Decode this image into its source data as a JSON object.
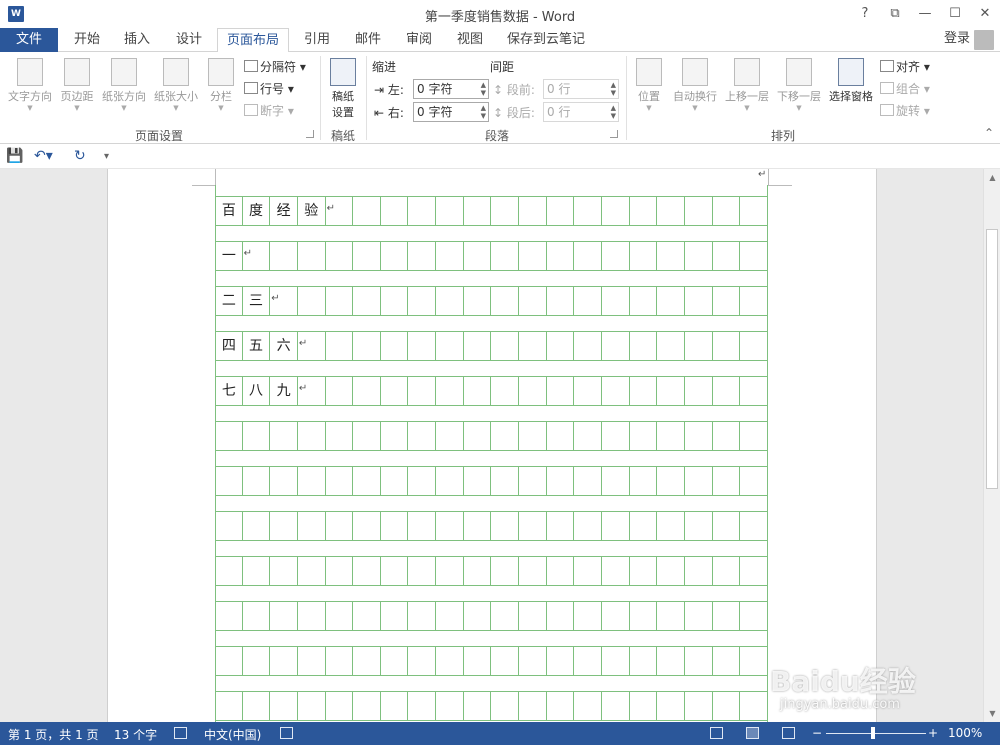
{
  "window": {
    "title": "第一季度销售数据 - Word",
    "help": "?",
    "restore_ribbon": "⧉",
    "minimize": "—",
    "maximize": "☐",
    "close": "✕"
  },
  "tabs": {
    "file": "文件",
    "items": [
      "开始",
      "插入",
      "设计",
      "页面布局",
      "引用",
      "邮件",
      "审阅",
      "视图",
      "保存到云笔记"
    ],
    "active": "页面布局",
    "login": "登录"
  },
  "ribbon": {
    "page_setup": {
      "label": "页面设置",
      "text_direction": "文字方向",
      "margins": "页边距",
      "orientation": "纸张方向",
      "size": "纸张大小",
      "columns": "分栏",
      "breaks": "分隔符",
      "line_numbers": "行号",
      "hyphenation": "断字"
    },
    "manuscript": {
      "label": "稿纸",
      "settings_line1": "稿纸",
      "settings_line2": "设置"
    },
    "paragraph": {
      "label": "段落",
      "indent_title": "缩进",
      "spacing_title": "间距",
      "left_label": "左:",
      "right_label": "右:",
      "left_value": "0 字符",
      "right_value": "0 字符",
      "before_label": "段前:",
      "after_label": "段后:",
      "before_value": "0 行",
      "after_value": "0 行"
    },
    "arrange": {
      "label": "排列",
      "position": "位置",
      "wrap_text": "自动换行",
      "bring_forward": "上移一层",
      "send_backward": "下移一层",
      "selection_pane": "选择窗格",
      "align": "对齐",
      "group": "组合",
      "rotate": "旋转"
    }
  },
  "document": {
    "rows": [
      [
        "百",
        "度",
        "经",
        "验"
      ],
      [
        "一"
      ],
      [
        "二",
        "三"
      ],
      [
        "四",
        "五",
        "六"
      ],
      [
        "七",
        "八",
        "九"
      ],
      [],
      [],
      [],
      [],
      [],
      [],
      []
    ],
    "paragraph_mark": "↵",
    "grid_color": "#7ec07e"
  },
  "statusbar": {
    "page": "第 1 页，共 1 页",
    "words": "13 个字",
    "language": "中文(中国)",
    "zoom": "100%",
    "zoom_minus": "−",
    "zoom_plus": "+"
  },
  "watermark": {
    "brand": "Baidu经验",
    "url": "jingyan.baidu.com"
  },
  "colors": {
    "accent": "#2b579a"
  }
}
